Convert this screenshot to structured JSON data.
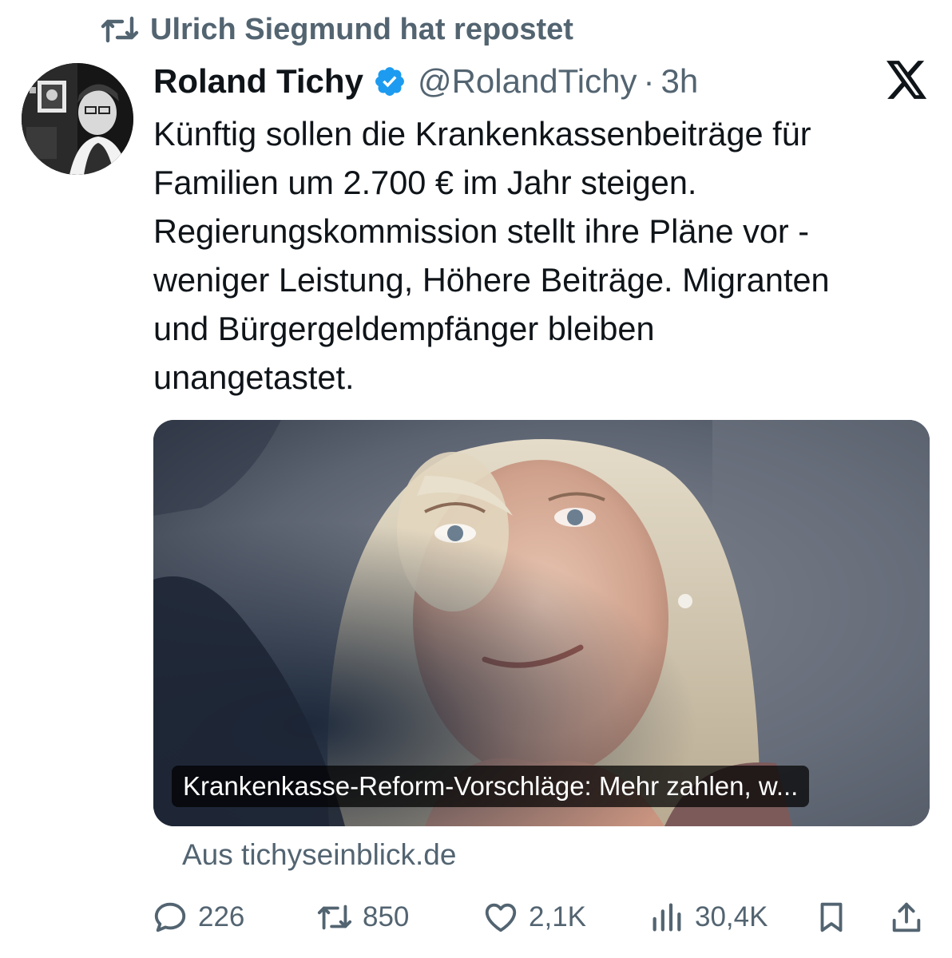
{
  "repost": {
    "text": "Ulrich Siegmund hat repostet"
  },
  "author": {
    "name": "Roland Tichy",
    "handle": "@RolandTichy",
    "separator": "·",
    "time": "3h"
  },
  "tweet": {
    "lines": [
      "Künftig sollen die Krankenkassenbeiträge für",
      "Familien um 2.700 € im Jahr steigen.",
      "Regierungskommission stellt ihre Pläne vor -",
      "weniger Leistung, Höhere Beiträge. Migranten",
      "und Bürgergeldempfänger bleiben",
      "unangetastet."
    ]
  },
  "card": {
    "title": "Krankenkasse-Reform-Vorschläge: Mehr zahlen, w...",
    "source": "Aus tichyseinblick.de"
  },
  "actions": {
    "replies": "226",
    "reposts": "850",
    "likes": "2,1K",
    "views": "30,4K"
  },
  "icons": {
    "repost": "repost-icon",
    "verified": "verified-badge-icon",
    "brand": "x-logo-icon",
    "reply": "reply-icon",
    "like": "heart-icon",
    "views": "views-icon",
    "bookmark": "bookmark-icon",
    "share": "share-icon"
  },
  "colors": {
    "secondary_text": "#536471",
    "verified_blue": "#1d9bf0",
    "text": "#0f1419"
  }
}
